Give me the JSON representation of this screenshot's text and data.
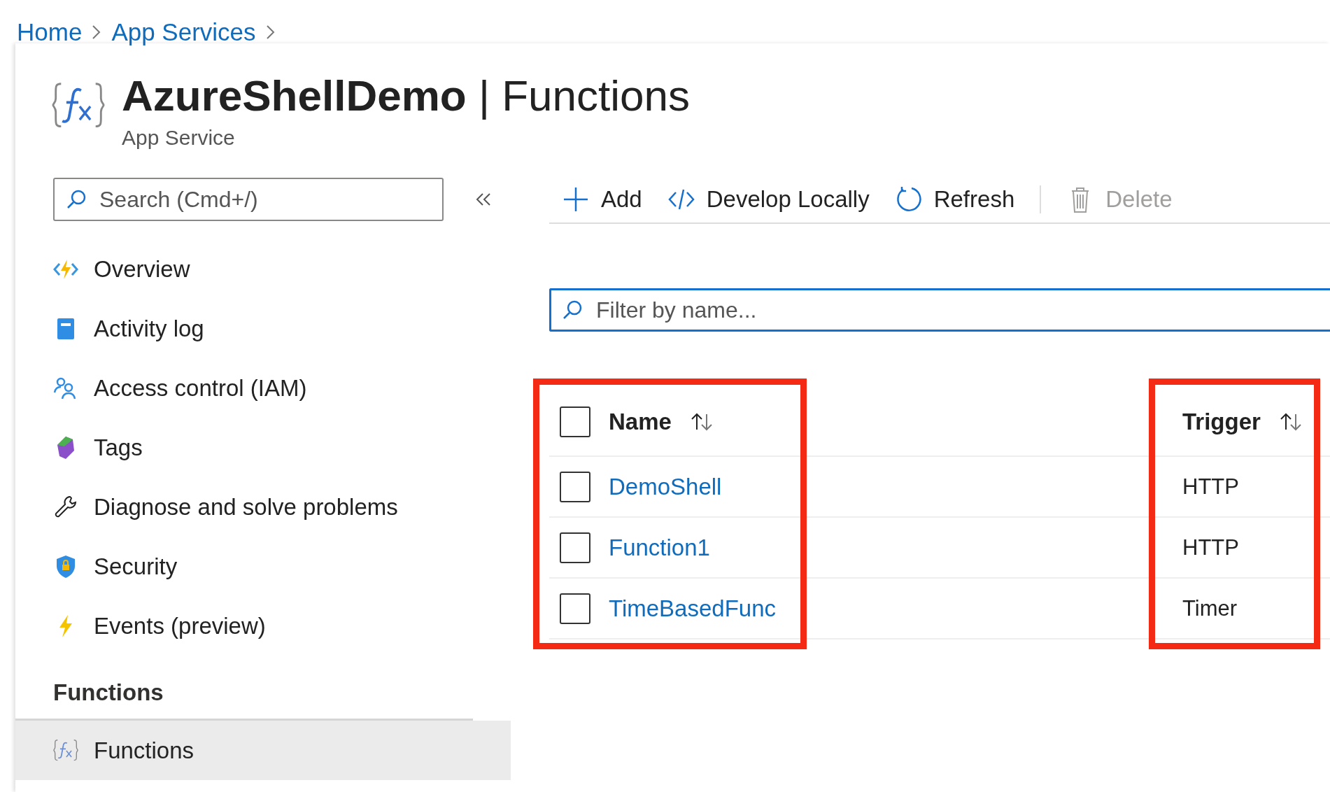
{
  "breadcrumb": [
    {
      "label": "Home"
    },
    {
      "label": "App Services"
    }
  ],
  "header": {
    "title": "**AzureShellDemo** | Functions",
    "subtitle": "App Service"
  },
  "sidebar": {
    "search": {
      "placeholder": "Search (Cmd+/)"
    },
    "items": [
      {
        "label": "Overview",
        "selected": false
      },
      {
        "label": "Activity log",
        "selected": false
      },
      {
        "label": "Access control (IAM)",
        "selected": false
      },
      {
        "label": "Tags",
        "selected": false
      },
      {
        "label": "Diagnose and solve problems",
        "selected": false
      },
      {
        "label": "Security",
        "selected": false
      },
      {
        "label": "Events (preview)",
        "selected": false
      }
    ],
    "section": {
      "title": "Functions",
      "items": [
        {
          "label": "Functions",
          "selected": true
        }
      ]
    }
  },
  "toolbar": [
    {
      "label": "Add",
      "disabled": false
    },
    {
      "label": "Develop Locally",
      "disabled": false
    },
    {
      "label": "Refresh",
      "disabled": false
    },
    {
      "label": "Delete",
      "disabled": true
    }
  ],
  "filter": {
    "placeholder": "Filter by name..."
  },
  "table": {
    "select_all": {
      "checked": false
    },
    "columns": [
      {
        "label": "Name",
        "highlighted": true
      },
      {
        "label": "Trigger",
        "highlighted": true
      }
    ],
    "rows": [
      {
        "name": "DemoShell",
        "trigger": "HTTP",
        "checked": false
      },
      {
        "name": "Function1",
        "trigger": "HTTP",
        "checked": false
      },
      {
        "name": "TimeBasedFunc",
        "trigger": "Timer",
        "checked": false
      }
    ]
  }
}
